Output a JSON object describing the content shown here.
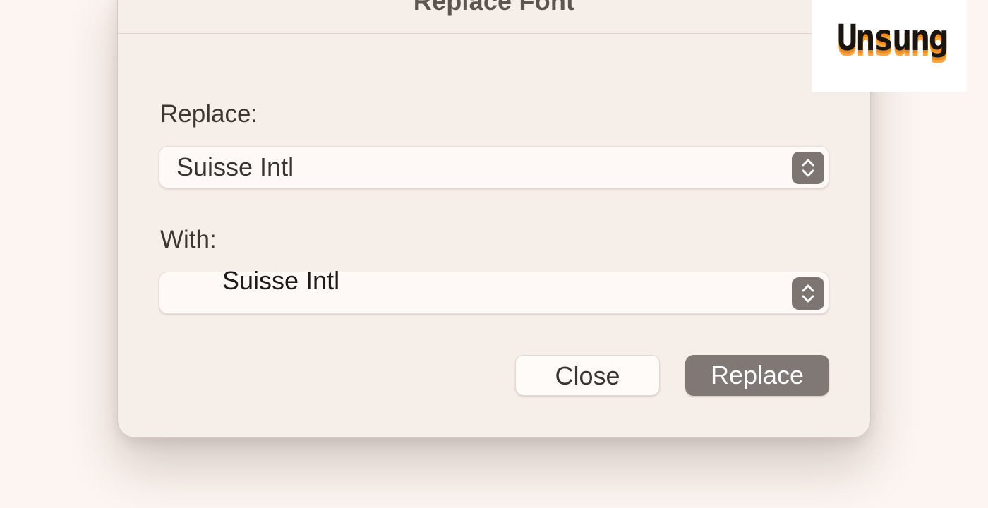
{
  "dialog": {
    "title": "Replace Font",
    "replace_label": "Replace:",
    "replace_value": "Suisse Intl",
    "with_label": "With:",
    "with_value": "Suisse Intl",
    "close_label": "Close",
    "replace_button_label": "Replace"
  },
  "icons": {
    "popup_stepper": "chevron-up-down-icon"
  },
  "logo": {
    "text": "Unsung",
    "colors": [
      "#1a1410",
      "#f08a18",
      "#f5a84a"
    ]
  },
  "colors": {
    "background": "#fcf5f1",
    "dialog": "#f6eee9",
    "primary_button": "#7f7874",
    "stepper": "#7c7571"
  }
}
